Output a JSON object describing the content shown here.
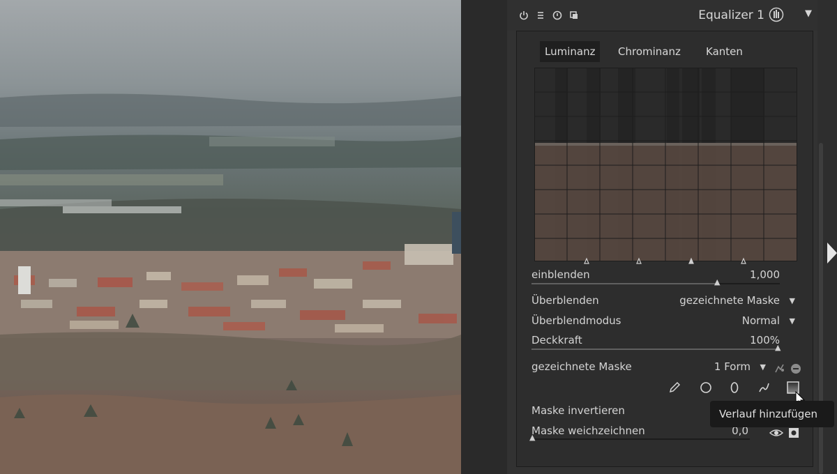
{
  "module": {
    "title": "Equalizer 1",
    "header_icons": [
      "power-icon",
      "hamburger-icon",
      "reset-icon",
      "duplicate-icon"
    ]
  },
  "tabs": [
    {
      "label": "Luminanz",
      "active": true
    },
    {
      "label": "Chrominanz",
      "active": false
    },
    {
      "label": "Kanten",
      "active": false
    }
  ],
  "graph": {
    "control_points": 4,
    "fill_color": "#55473f"
  },
  "blend_row": {
    "label": "einblenden",
    "value": "1,000",
    "level": 0.7
  },
  "blending": {
    "label": "Überblenden",
    "value": "gezeichnete Maske"
  },
  "blend_mode": {
    "label": "Überblendmodus",
    "value": "Normal"
  },
  "opacity": {
    "label": "Deckkraft",
    "value": "100%",
    "level": 1.0
  },
  "drawn_mask": {
    "label": "gezeichnete Maske",
    "value": "1 Form",
    "tools": [
      "pencil-icon",
      "circle-icon",
      "ellipse-icon",
      "path-icon",
      "gradient-icon"
    ]
  },
  "invert_mask": {
    "label": "Maske invertieren"
  },
  "feather_mask": {
    "label": "Maske weichzeichnen",
    "value": "0,0",
    "level": 0.0
  },
  "tooltip": {
    "text": "Verlauf hinzufügen"
  },
  "colors": {
    "panel": "#323232",
    "accent_fill": "#55473f",
    "tooltip_bg": "#1a1a1a"
  }
}
